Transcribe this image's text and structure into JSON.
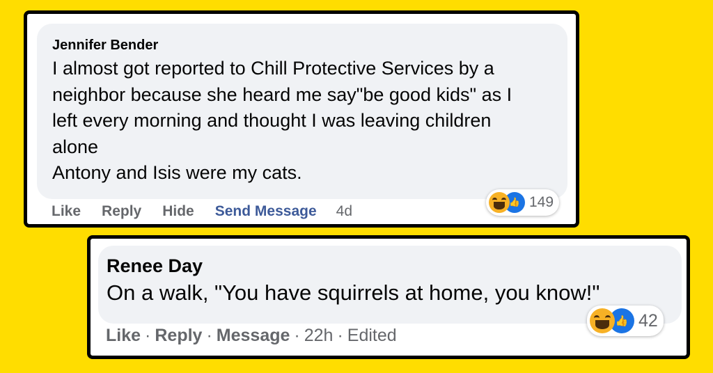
{
  "comment1": {
    "author": "Jennifer Bender",
    "text_lines": [
      "I almost got reported to Chill Protective Services by a",
      "neighbor because she heard me say\"be good kids\" as I",
      "left every morning and thought I was leaving children",
      "alone",
      "Antony and Isis were my cats."
    ],
    "actions": {
      "like": "Like",
      "reply": "Reply",
      "hide": "Hide",
      "send": "Send Message",
      "time": "4d"
    },
    "reactions": {
      "icons": [
        "haha-icon",
        "like-icon"
      ],
      "count": "149"
    }
  },
  "comment2": {
    "author": "Renee Day",
    "text": "On a walk, \"You have squirrels at home, you know!\"",
    "actions": {
      "like": "Like",
      "reply": "Reply",
      "message": "Message",
      "time": "22h",
      "edited": "Edited"
    },
    "reactions": {
      "icons": [
        "haha-icon",
        "like-icon"
      ],
      "count": "42"
    }
  },
  "colors": {
    "background": "#ffdd00",
    "bubble": "#f0f2f5",
    "link": "#3d5a99",
    "muted": "#65676b"
  }
}
